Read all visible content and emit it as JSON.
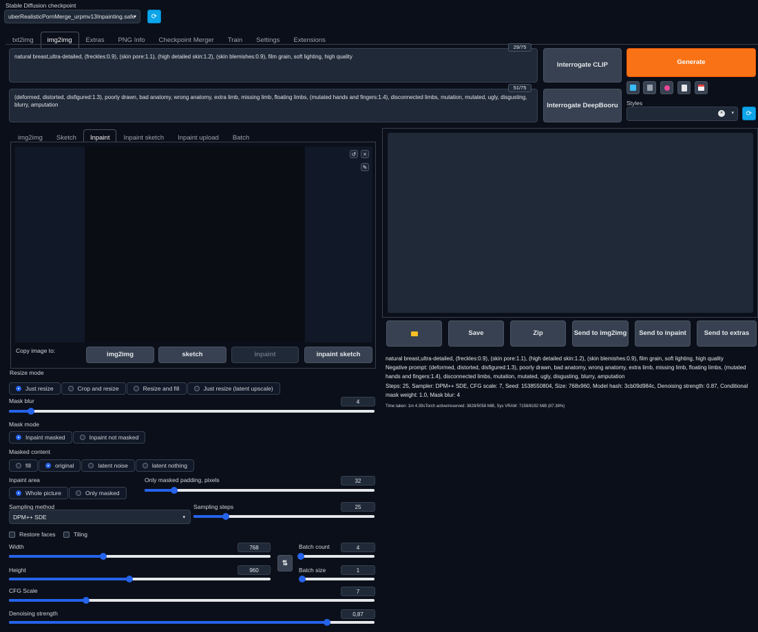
{
  "checkpoint": {
    "label": "Stable Diffusion checkpoint",
    "value": "uberRealisticPornMerge_urpmv13Inpainting.safe"
  },
  "main_tabs": [
    "txt2img",
    "img2img",
    "Extras",
    "PNG Info",
    "Checkpoint Merger",
    "Train",
    "Settings",
    "Extensions"
  ],
  "prompt": {
    "text": "natural breast,ultra-detailed, (freckles:0.9), (skin pore:1.1), (high detailed skin:1.2), (skin blemishes:0.9), film grain, soft lighting, high quality",
    "count": "29/75"
  },
  "negative": {
    "text": "(deformed, distorted, disfigured:1.3), poorly drawn, bad anatomy, wrong anatomy, extra limb, missing limb, floating limbs, (mutated hands and fingers:1.4), disconnected limbs, mutation, mutated, ugly, disgusting, blurry, amputation",
    "count": "51/75"
  },
  "buttons": {
    "interrogate_clip": "Interrogate CLIP",
    "interrogate_deepbooru": "Interrogate DeepBooru",
    "generate": "Generate"
  },
  "styles_label": "Styles",
  "sub_tabs": [
    "img2img",
    "Sketch",
    "Inpaint",
    "Inpaint sketch",
    "Inpaint upload",
    "Batch"
  ],
  "copy": {
    "label": "Copy image to:",
    "buttons": [
      "img2img",
      "sketch",
      "inpaint",
      "inpaint sketch"
    ]
  },
  "resize": {
    "label": "Resize mode",
    "options": [
      "Just resize",
      "Crop and resize",
      "Resize and fill",
      "Just resize (latent upscale)"
    ]
  },
  "mask_blur": {
    "label": "Mask blur",
    "value": "4",
    "fraction": 0.06
  },
  "mask_mode": {
    "label": "Mask mode",
    "options": [
      "Inpaint masked",
      "Inpaint not masked"
    ]
  },
  "masked_content": {
    "label": "Masked content",
    "options": [
      "fill",
      "original",
      "latent noise",
      "latent nothing"
    ]
  },
  "inpaint_area": {
    "label": "Inpaint area",
    "options": [
      "Whole picture",
      "Only masked"
    ]
  },
  "padding": {
    "label": "Only masked padding, pixels",
    "value": "32",
    "fraction": 0.13
  },
  "sampling_method": {
    "label": "Sampling method",
    "value": "DPM++ SDE"
  },
  "sampling_steps": {
    "label": "Sampling steps",
    "value": "25",
    "fraction": 0.18
  },
  "checks": {
    "restore": "Restore faces",
    "tiling": "Tiling"
  },
  "width": {
    "label": "Width",
    "value": "768",
    "fraction": 0.36
  },
  "height": {
    "label": "Height",
    "value": "960",
    "fraction": 0.46
  },
  "batch_count": {
    "label": "Batch count",
    "value": "4",
    "fraction": 0.03
  },
  "batch_size": {
    "label": "Batch size",
    "value": "1",
    "fraction": 0.0
  },
  "cfg": {
    "label": "CFG Scale",
    "value": "7",
    "fraction": 0.21
  },
  "denoise": {
    "label": "Denoising strength",
    "value": "0,87",
    "fraction": 0.87
  },
  "output_buttons": [
    "",
    "Save",
    "Zip",
    "Send to img2img",
    "Send to inpaint",
    "Send to extras"
  ],
  "info": {
    "line1": "natural breast,ultra-detailed, (freckles:0.9), (skin pore:1.1), (high detailed skin:1.2), (skin blemishes:0.9), film grain, soft lighting, high quality",
    "line2": "Negative prompt: (deformed, distorted, disfigured:1.3), poorly drawn, bad anatomy, wrong anatomy, extra limb, missing limb, floating limbs, (mutated hands and fingers:1.4), disconnected limbs, mutation, mutated, ugly, disgusting, blurry, amputation",
    "line3": "Steps: 25, Sampler: DPM++ SDE, CFG scale: 7, Seed: 1538550804, Size: 768x960, Model hash: 3cb09d984c, Denoising strength: 0.87, Conditional mask weight: 1.0, Mask blur: 4",
    "time": "Time taken: 1m 4.39sTorch active/reserved: 3828/5058 MiB, Sys VRAM: 7158/8192 MiB (87.38%)"
  }
}
